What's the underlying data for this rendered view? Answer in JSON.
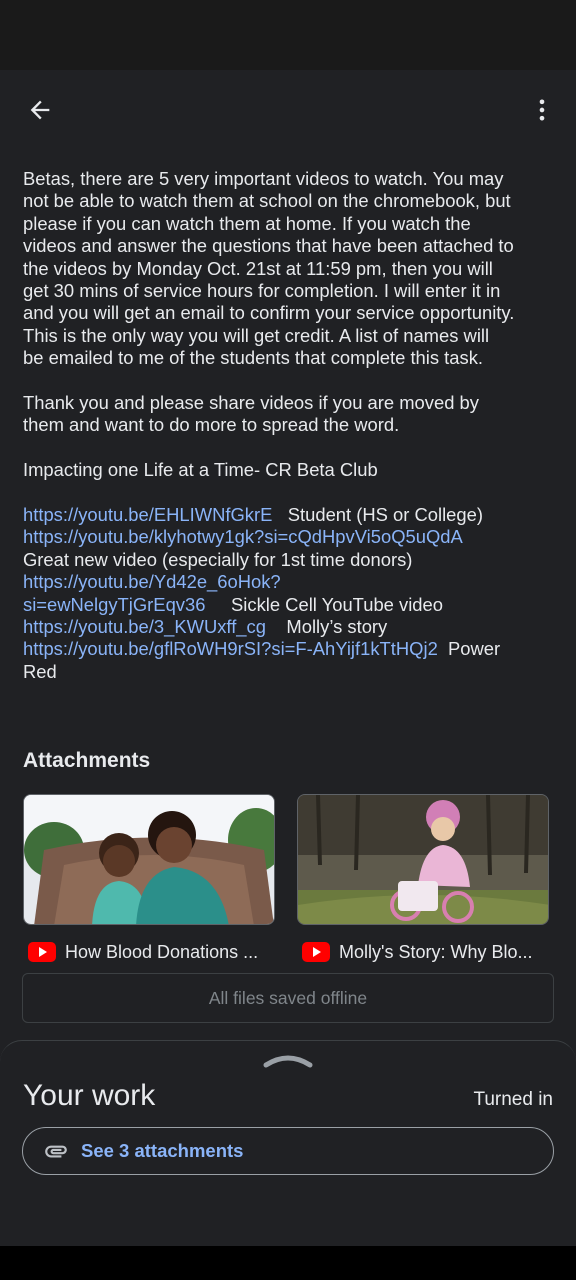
{
  "body": {
    "paragraph1": [
      "Betas, there are 5 very important videos to watch. You may",
      "not be able to watch them at school on the chromebook, but",
      "please if you can watch them at home. If you watch the",
      "videos and answer the questions that have been attached to",
      "the videos by Monday Oct. 21st at 11:59 pm, then you will",
      "get 30 mins of service hours for completion. I will enter it in",
      "and you will get an email to confirm your service opportunity.",
      "This is the only way you will get credit. A list of names will",
      "be emailed to me of the students that complete this task."
    ],
    "paragraph2": [
      "Thank you and please share videos if you are moved by",
      "them and want to do more to spread the word."
    ],
    "paragraph3": "Impacting one Life at a Time- CR Beta Club",
    "links": {
      "link1": "https://youtu.be/EHLIWNfGkrE",
      "link1_desc": "Student (HS or College)",
      "link2": "https://youtu.be/klyhotwy1gk?si=cQdHpvVi5oQ5uQdA",
      "link2_desc": "Great new video (especially for 1st time donors)",
      "link3a": "https://youtu.be/Yd42e_6oHok?",
      "link3b": "si=ewNelgyTjGrEqv36",
      "link3_desc": "Sickle Cell YouTube video",
      "link4": "https://youtu.be/3_KWUxff_cg",
      "link4_desc": "Molly’s story",
      "link5": "https://youtu.be/gflRoWH9rSI?si=F-AhYijf1kTtHQj2",
      "link5_desc_a": "Power",
      "link5_desc_b": "Red"
    }
  },
  "attachments": {
    "title": "Attachments",
    "items": [
      {
        "label": "How Blood Donations ..."
      },
      {
        "label": "Molly's Story: Why Blo..."
      }
    ],
    "offline_status": "All files saved offline"
  },
  "your_work": {
    "title": "Your work",
    "status": "Turned in",
    "see_attachments": "See 3 attachments"
  },
  "colors": {
    "link": "#8ab4f8",
    "background": "#202124",
    "youtube_red": "#ff0000"
  }
}
